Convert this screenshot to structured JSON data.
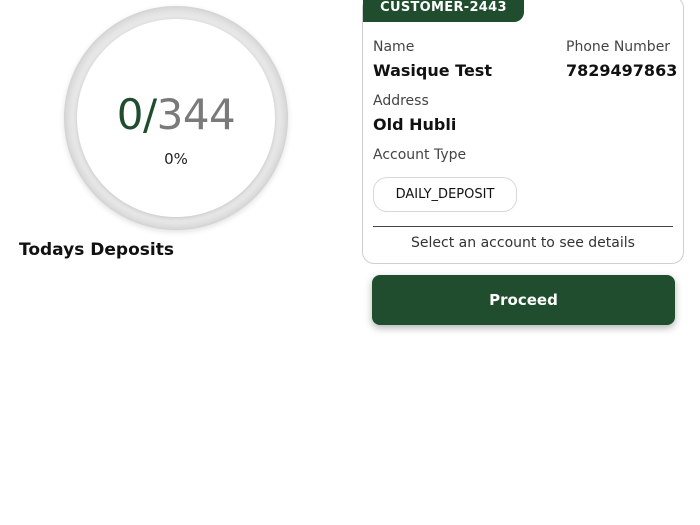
{
  "deposits": {
    "completed": "0",
    "separator": "/",
    "total": "344",
    "percent_text": "0%",
    "progress": 0,
    "title": "Todays Deposits"
  },
  "customer_card": {
    "customer_id": "CUSTOMER-2443",
    "name_label": "Name",
    "name_value": "Wasique Test",
    "phone_label": "Phone Number",
    "phone_value": "7829497863",
    "address_label": "Address",
    "address_value": "Old Hubli",
    "account_type_label": "Account Type",
    "account_type_value": "DAILY_DEPOSIT",
    "hint": "Select an account to see details"
  },
  "actions": {
    "proceed_label": "Proceed"
  },
  "colors": {
    "primary": "#1f4d2e",
    "muted_number": "#7a7a7a",
    "ring": "#e8e8e8"
  }
}
